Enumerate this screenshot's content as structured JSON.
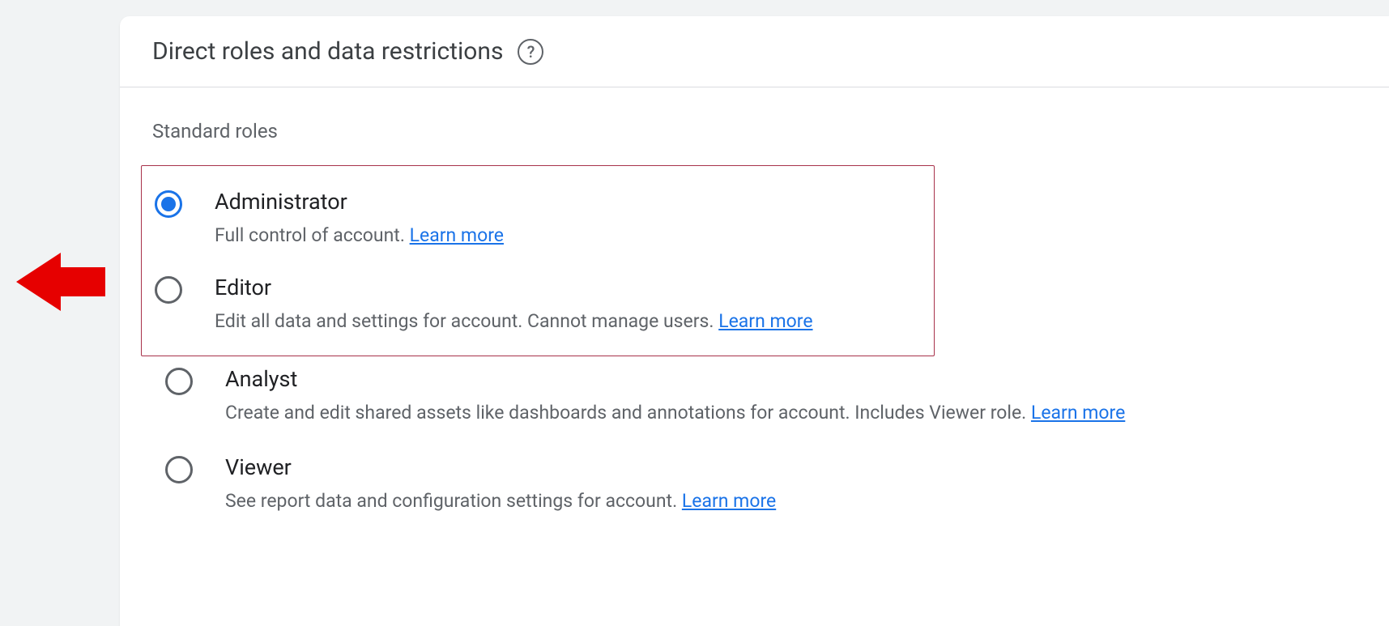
{
  "header": {
    "title": "Direct roles and data restrictions",
    "help_glyph": "?"
  },
  "section_label": "Standard roles",
  "learn_more_label": "Learn more",
  "roles": [
    {
      "id": "administrator",
      "title": "Administrator",
      "desc": "Full control of account. ",
      "selected": true,
      "highlighted": true
    },
    {
      "id": "editor",
      "title": "Editor",
      "desc": "Edit all data and settings for account. Cannot manage users. ",
      "selected": false,
      "highlighted": true
    },
    {
      "id": "analyst",
      "title": "Analyst",
      "desc": "Create and edit shared assets like dashboards and annotations for account. Includes Viewer role. ",
      "selected": false,
      "highlighted": false
    },
    {
      "id": "viewer",
      "title": "Viewer",
      "desc": "See report data and configuration settings for account. ",
      "selected": false,
      "highlighted": false
    }
  ]
}
